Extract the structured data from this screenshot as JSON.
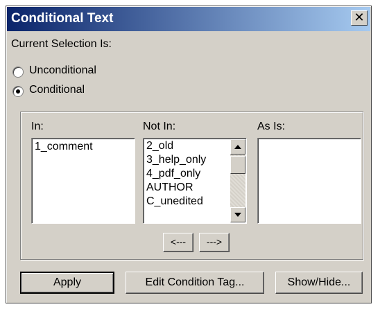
{
  "window": {
    "title": "Conditional Text"
  },
  "close_glyph": "✕",
  "current_selection_label": "Current Selection Is:",
  "radios": [
    {
      "label": "Unconditional",
      "checked": false
    },
    {
      "label": "Conditional",
      "checked": true
    }
  ],
  "lists": {
    "in": {
      "label": "In:",
      "items": [
        "1_comment"
      ]
    },
    "not_in": {
      "label": "Not In:",
      "items": [
        "2_old",
        "3_help_only",
        "4_pdf_only",
        "AUTHOR",
        "C_unedited"
      ]
    },
    "as_is": {
      "label": "As Is:",
      "items": []
    }
  },
  "move_buttons": {
    "left": "<---",
    "right": "--->"
  },
  "buttons": {
    "apply": "Apply",
    "edit": "Edit Condition Tag...",
    "show_hide": "Show/Hide..."
  },
  "colors": {
    "titlebar": "#0a246a",
    "dialog_bg": "#d4d0c8"
  }
}
